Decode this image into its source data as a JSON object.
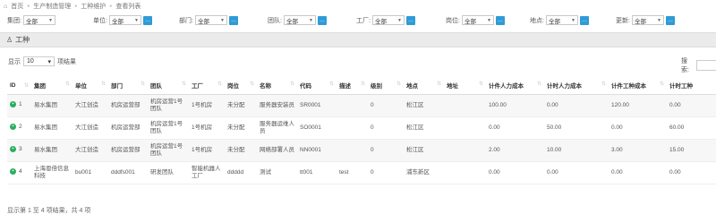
{
  "breadcrumb": [
    "首页",
    "生产制造管理",
    "工种维护",
    "查看列表"
  ],
  "filters": [
    {
      "label": "集团:",
      "value": "全部"
    },
    {
      "label": "单位:",
      "value": "全部"
    },
    {
      "label": "部门:",
      "value": "全部"
    },
    {
      "label": "团队:",
      "value": "全部"
    },
    {
      "label": "工厂:",
      "value": "全部"
    },
    {
      "label": "岗位:",
      "value": "全部"
    },
    {
      "label": "地点:",
      "value": "全部"
    },
    {
      "label": "更新:",
      "value": "全部"
    }
  ],
  "panel_title": "工种",
  "length_menu": {
    "prefix": "显示",
    "value": "10",
    "suffix": "项结果"
  },
  "search_label": "搜索:",
  "columns": [
    "ID",
    "集团",
    "单位",
    "部门",
    "团队",
    "工厂",
    "岗位",
    "名称",
    "代码",
    "描述",
    "级别",
    "地点",
    "地址",
    "计件人力成本",
    "计时人力成本",
    "计件工种成本",
    "计时工种"
  ],
  "rows": [
    {
      "id": "1",
      "cells": [
        "易水集团",
        "大江创造",
        "机房运营部",
        "机房运营1号团队",
        "1号机房",
        "未分配",
        "服务器安装员",
        "SR0001",
        "",
        "0",
        "松江区",
        "",
        "100.00",
        "0.00",
        "120.00",
        "0.00"
      ]
    },
    {
      "id": "2",
      "cells": [
        "易水集团",
        "大江创造",
        "机房运营部",
        "机房运营1号团队",
        "1号机房",
        "未分配",
        "服务器运维人员",
        "SO0001",
        "",
        "0",
        "松江区",
        "",
        "0.00",
        "50.00",
        "0.00",
        "60.00"
      ]
    },
    {
      "id": "3",
      "cells": [
        "易水集团",
        "大江创造",
        "机房运营部",
        "机房运营1号团队",
        "1号机房",
        "未分配",
        "网络部署人员",
        "NN0001",
        "",
        "0",
        "松江区",
        "",
        "2.00",
        "10.00",
        "3.00",
        "15.00"
      ]
    },
    {
      "id": "4",
      "cells": [
        "上海恩倍信息科技",
        "bu001",
        "dddfs001",
        "研发团队",
        "智能机器人工厂",
        "ddddd",
        "测试",
        "tt001",
        "test",
        "0",
        "浦东新区",
        "",
        "0.00",
        "0.00",
        "0.00",
        "0.00"
      ]
    }
  ],
  "footer": "显示第 1 至 4 项结果，共 4 项"
}
